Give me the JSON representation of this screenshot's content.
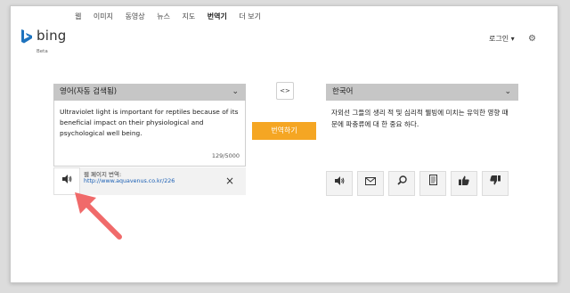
{
  "nav": {
    "items": [
      "웹",
      "이미지",
      "동영상",
      "뉴스",
      "지도",
      "번역기",
      "더 보기"
    ],
    "active": "번역기"
  },
  "brand": {
    "name": "bing",
    "tag": "Beta"
  },
  "header": {
    "login": "로그인 ▾",
    "settings_icon": "gear-icon"
  },
  "source": {
    "language": "영어(자동 검색됨)",
    "text": "Ultraviolet light is important for reptiles because of its beneficial impact on their physiological and psychological well being.",
    "counter": "129/5000",
    "webpage_label": "웹 페이지 번역:",
    "webpage_link": "http://www.aquavenus.co.kr/226"
  },
  "swap": {
    "label": "<>"
  },
  "translate_button": "번역하기",
  "target": {
    "language": "한국어",
    "text": "자외선 그들의 생리 적 및 심리적 웰빙에 미치는 유익한 영향 때문에 파충류에 대 한 중요 하다."
  },
  "tools": {
    "speak": "speaker-icon",
    "email": "envelope-icon",
    "search": "magnifier-icon",
    "copy": "document-icon",
    "like": "thumbs-up-icon",
    "dislike": "thumbs-down-icon",
    "clear": "×"
  },
  "annotation": {
    "arrow_color": "#f06a6a"
  },
  "colors": {
    "accent": "#f5a623",
    "bar": "#c6c6c6"
  }
}
